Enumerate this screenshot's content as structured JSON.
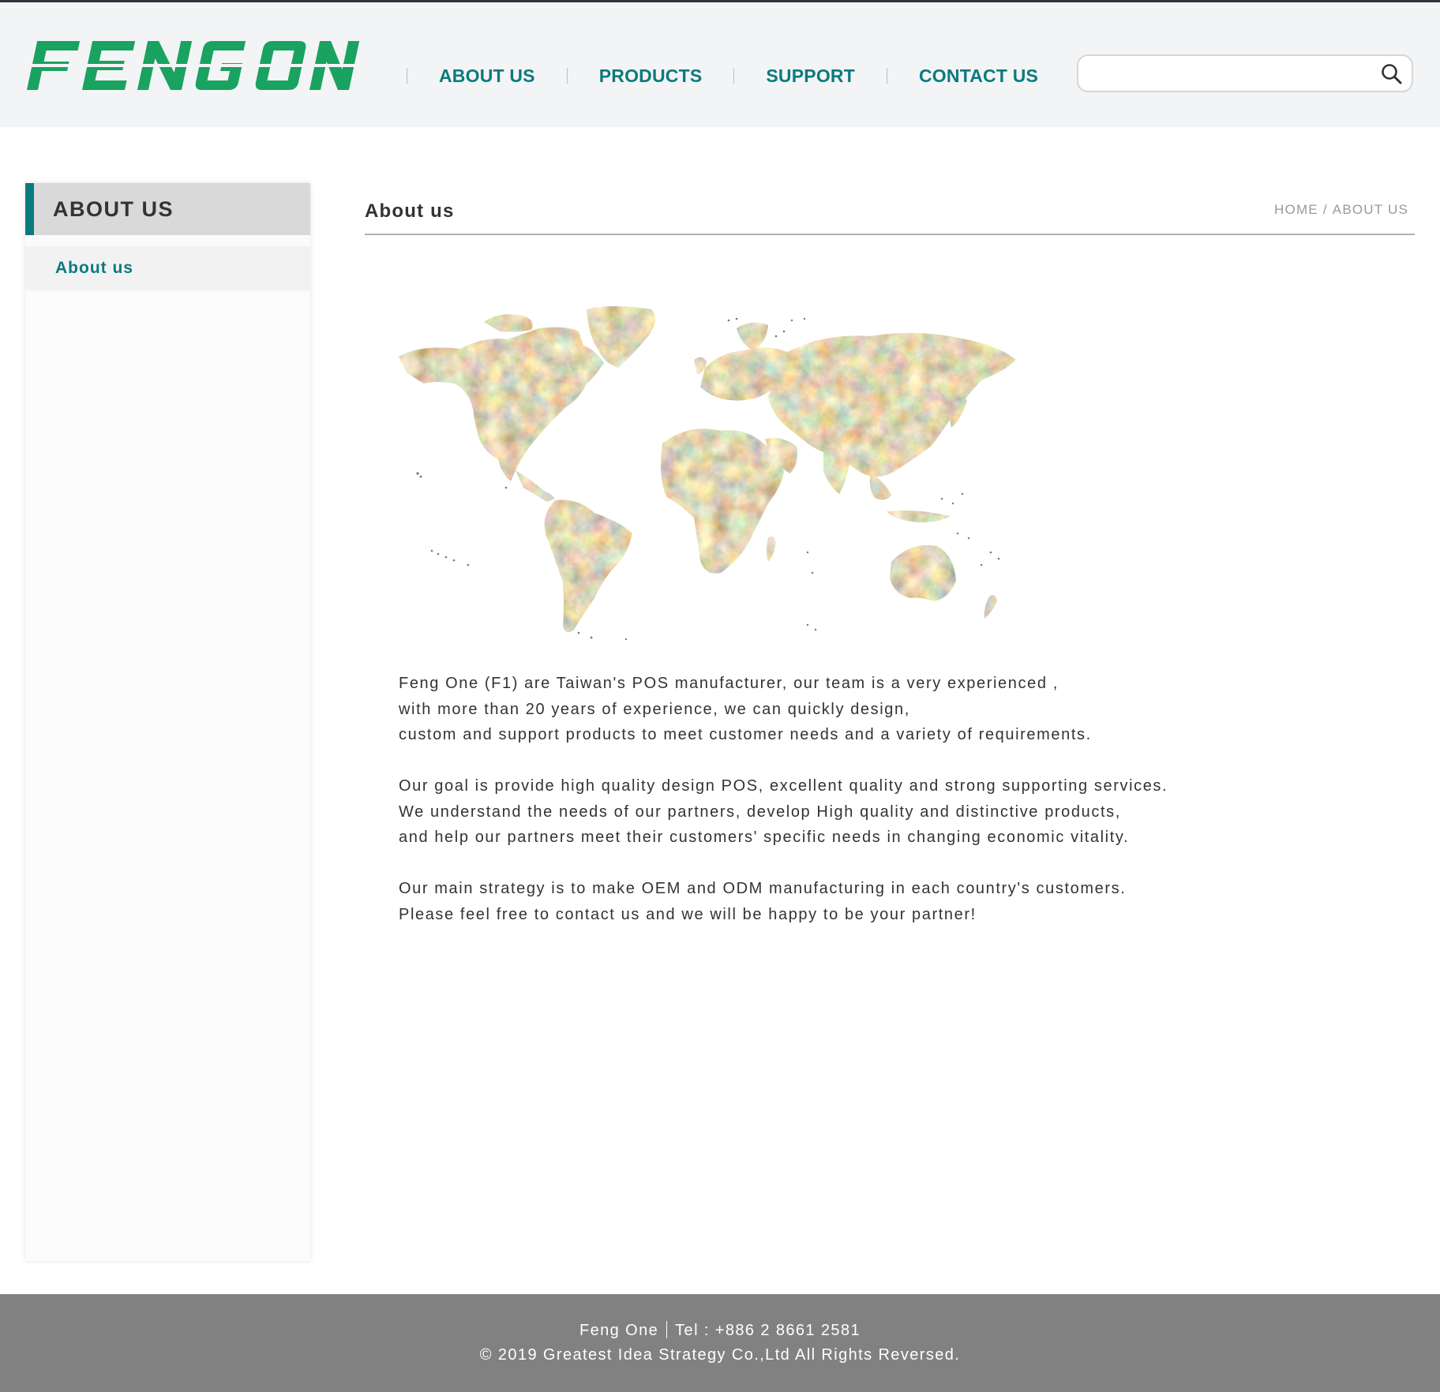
{
  "brand": {
    "logo_text": "FENG ONE",
    "logo_color": "#1aa260"
  },
  "nav": {
    "items": [
      "ABOUT US",
      "PRODUCTS",
      "SUPPORT",
      "CONTACT US"
    ],
    "color": "#0b7a7e"
  },
  "search": {
    "value": "",
    "placeholder": "",
    "icon": "search-icon"
  },
  "sidebar": {
    "title": "ABOUT US",
    "items": [
      {
        "label": "About us"
      }
    ]
  },
  "main": {
    "title": "About us",
    "breadcrumb": [
      "HOME",
      "/",
      "ABOUT US"
    ],
    "image": "world-map",
    "paragraphs": [
      [
        "Feng One (F1) are Taiwan's POS manufacturer, our team is a very experienced ,",
        "with more than 20 years of experience, we can quickly design,",
        "custom and support products to meet customer needs and a variety of requirements."
      ],
      [
        "Our goal is provide high quality design POS, excellent quality and strong supporting services.",
        "We understand the needs of our partners, develop High quality and distinctive products,",
        "and help our partners meet their customers' specific needs in changing economic vitality."
      ],
      [
        "Our main strategy is to make OEM and ODM manufacturing in each country's customers.",
        "Please feel free to contact us and we will be happy to be your partner!"
      ]
    ]
  },
  "footer": {
    "company": "Feng One",
    "tel": "Tel :  +886 2 8661 2581",
    "copyright": "© 2019 Greatest Idea Strategy Co.,Ltd All Rights Reversed."
  },
  "colors": {
    "accent": "#0b7a7e",
    "header_bg": "#f3f4f5",
    "footer_bg": "#818181"
  }
}
